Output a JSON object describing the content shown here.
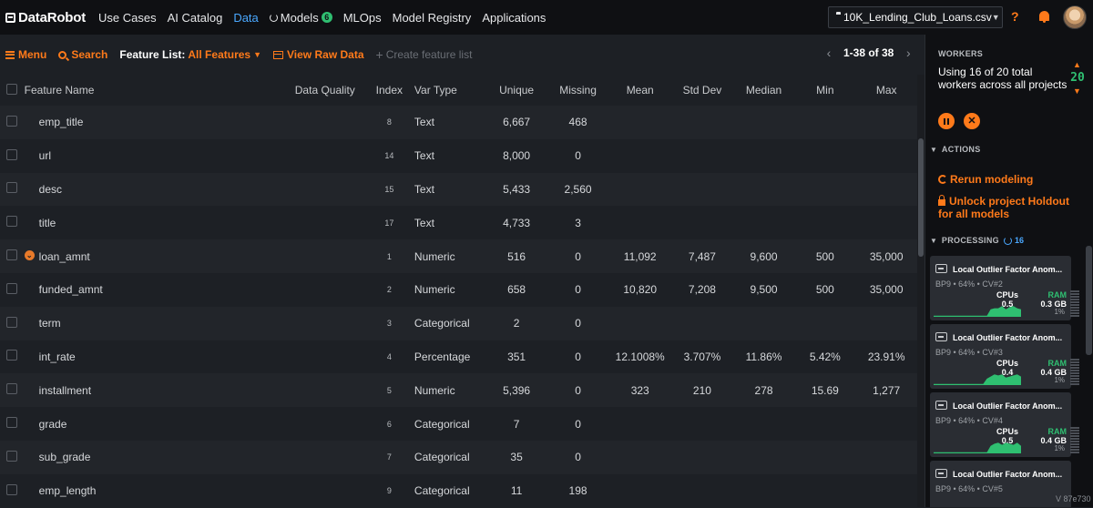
{
  "brand": {
    "name": "DataRobot"
  },
  "nav": [
    {
      "label": "Use Cases",
      "active": false
    },
    {
      "label": "AI Catalog",
      "active": false
    },
    {
      "label": "Data",
      "active": true
    },
    {
      "label": "Models",
      "active": false,
      "badge": "6",
      "icon": "spinner-icon"
    },
    {
      "label": "MLOps",
      "active": false
    },
    {
      "label": "Model Registry",
      "active": false
    },
    {
      "label": "Applications",
      "active": false
    }
  ],
  "project": {
    "name": "10K_Lending_Club_Loans.csv",
    "icon": "folder-icon"
  },
  "topbar_icons": {
    "help": "?",
    "notifications": "bell-icon"
  },
  "colors": {
    "accent": "#ff7a1a",
    "active_nav": "#4aa8ff",
    "success": "#2fbf71",
    "background": "#1d2025"
  },
  "toolbar": {
    "menu_label": "Menu",
    "search_label": "Search",
    "feature_list_label": "Feature List:",
    "feature_list_value": "All Features",
    "view_raw_label": "View Raw Data",
    "create_list_label": "Create feature list",
    "pager_range": "1-38 of 38"
  },
  "table": {
    "columns": [
      "Feature Name",
      "Data Quality",
      "Index",
      "Var Type",
      "Unique",
      "Missing",
      "Mean",
      "Std Dev",
      "Median",
      "Min",
      "Max"
    ],
    "rows": [
      {
        "name": "emp_title",
        "index": "8",
        "type": "Text",
        "unique": "6,667",
        "missing": "468",
        "mean": "",
        "std": "",
        "median": "",
        "min": "",
        "max": ""
      },
      {
        "name": "url",
        "index": "14",
        "type": "Text",
        "unique": "8,000",
        "missing": "0",
        "mean": "",
        "std": "",
        "median": "",
        "min": "",
        "max": ""
      },
      {
        "name": "desc",
        "index": "15",
        "type": "Text",
        "unique": "5,433",
        "missing": "2,560",
        "mean": "",
        "std": "",
        "median": "",
        "min": "",
        "max": ""
      },
      {
        "name": "title",
        "index": "17",
        "type": "Text",
        "unique": "4,733",
        "missing": "3",
        "mean": "",
        "std": "",
        "median": "",
        "min": "",
        "max": ""
      },
      {
        "name": "loan_amnt",
        "index": "1",
        "type": "Numeric",
        "unique": "516",
        "missing": "0",
        "mean": "11,092",
        "std": "7,487",
        "median": "9,600",
        "min": "500",
        "max": "35,000",
        "expanded": true
      },
      {
        "name": "funded_amnt",
        "index": "2",
        "type": "Numeric",
        "unique": "658",
        "missing": "0",
        "mean": "10,820",
        "std": "7,208",
        "median": "9,500",
        "min": "500",
        "max": "35,000"
      },
      {
        "name": "term",
        "index": "3",
        "type": "Categorical",
        "unique": "2",
        "missing": "0",
        "mean": "",
        "std": "",
        "median": "",
        "min": "",
        "max": ""
      },
      {
        "name": "int_rate",
        "index": "4",
        "type": "Percentage",
        "unique": "351",
        "missing": "0",
        "mean": "12.1008%",
        "std": "3.707%",
        "median": "11.86%",
        "min": "5.42%",
        "max": "23.91%"
      },
      {
        "name": "installment",
        "index": "5",
        "type": "Numeric",
        "unique": "5,396",
        "missing": "0",
        "mean": "323",
        "std": "210",
        "median": "278",
        "min": "15.69",
        "max": "1,277"
      },
      {
        "name": "grade",
        "index": "6",
        "type": "Categorical",
        "unique": "7",
        "missing": "0",
        "mean": "",
        "std": "",
        "median": "",
        "min": "",
        "max": ""
      },
      {
        "name": "sub_grade",
        "index": "7",
        "type": "Categorical",
        "unique": "35",
        "missing": "0",
        "mean": "",
        "std": "",
        "median": "",
        "min": "",
        "max": ""
      },
      {
        "name": "emp_length",
        "index": "9",
        "type": "Categorical",
        "unique": "11",
        "missing": "198",
        "mean": "",
        "std": "",
        "median": "",
        "min": "",
        "max": ""
      }
    ]
  },
  "sidebar": {
    "workers_heading": "WORKERS",
    "workers_text": "Using 16 of 20 total workers across all projects",
    "workers_count": "20",
    "actions_heading": "ACTIONS",
    "rerun_label": "Rerun modeling",
    "unlock_label": "Unlock project Holdout for all models",
    "processing_heading": "PROCESSING",
    "processing_count": "16",
    "jobs": [
      {
        "title": "Local Outlier Factor Anom...",
        "meta": "BP9 • 64% • CV#2",
        "cpu_label": "CPUs",
        "cpu": "0.5",
        "ram_label": "RAM",
        "ram": "0.3 GB",
        "ram_pct": "1%",
        "activity": [
          0,
          0,
          0,
          0,
          0,
          0,
          0,
          0,
          0,
          0,
          0,
          0,
          0,
          0,
          0,
          0.6,
          0.7,
          0.7,
          0.9,
          0.6,
          0.8,
          0.9,
          0.7,
          0.6
        ]
      },
      {
        "title": "Local Outlier Factor Anom...",
        "meta": "BP9 • 64% • CV#3",
        "cpu_label": "CPUs",
        "cpu": "0.4",
        "ram_label": "RAM",
        "ram": "0.4 GB",
        "ram_pct": "1%",
        "activity": [
          0,
          0,
          0,
          0,
          0,
          0,
          0,
          0,
          0,
          0,
          0,
          0,
          0,
          0,
          0.5,
          0.7,
          0.9,
          0.8,
          0.9,
          0.6,
          0.7,
          0.8,
          0.9,
          0.7
        ]
      },
      {
        "title": "Local Outlier Factor Anom...",
        "meta": "BP9 • 64% • CV#4",
        "cpu_label": "CPUs",
        "cpu": "0.5",
        "ram_label": "RAM",
        "ram": "0.4 GB",
        "ram_pct": "1%",
        "activity": [
          0,
          0,
          0,
          0,
          0,
          0,
          0,
          0,
          0,
          0,
          0,
          0,
          0,
          0,
          0,
          0.6,
          0.8,
          0.9,
          0.7,
          0.9,
          0.8,
          0.7,
          0.9,
          0.6
        ]
      },
      {
        "title": "Local Outlier Factor Anom...",
        "meta": "BP9 • 64% • CV#5",
        "cpu_label": "",
        "cpu": "",
        "ram_label": "",
        "ram": "",
        "ram_pct": "",
        "activity": []
      }
    ],
    "version": "V 87e730"
  }
}
